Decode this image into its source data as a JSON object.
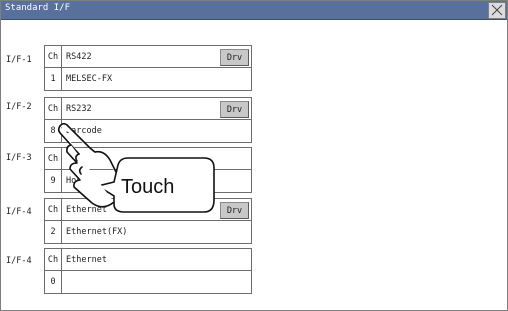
{
  "window": {
    "title": "Standard I/F"
  },
  "interfaces": [
    {
      "label": "I/F-1",
      "ch_header": "Ch",
      "type": "RS422",
      "ch": "1",
      "driver": "MELSEC-FX",
      "drv_label": "Drv"
    },
    {
      "label": "I/F-2",
      "ch_header": "Ch",
      "type": "RS232",
      "ch": "8",
      "driver": "Barcode",
      "drv_label": "Drv"
    },
    {
      "label": "I/F-3",
      "ch_header": "Ch",
      "type": "",
      "ch": "9",
      "driver": "Host",
      "drv_label": ""
    },
    {
      "label": "I/F-4",
      "ch_header": "Ch",
      "type": "Ethernet",
      "ch": "2",
      "driver": "Ethernet(FX)",
      "drv_label": "Drv"
    },
    {
      "label": "I/F-4",
      "ch_header": "Ch",
      "type": "Ethernet",
      "ch": "0",
      "driver": "",
      "drv_label": ""
    }
  ],
  "callout": {
    "text": "Touch"
  },
  "icons": {
    "close": "close-icon",
    "pointer": "hand-pointer-icon"
  }
}
